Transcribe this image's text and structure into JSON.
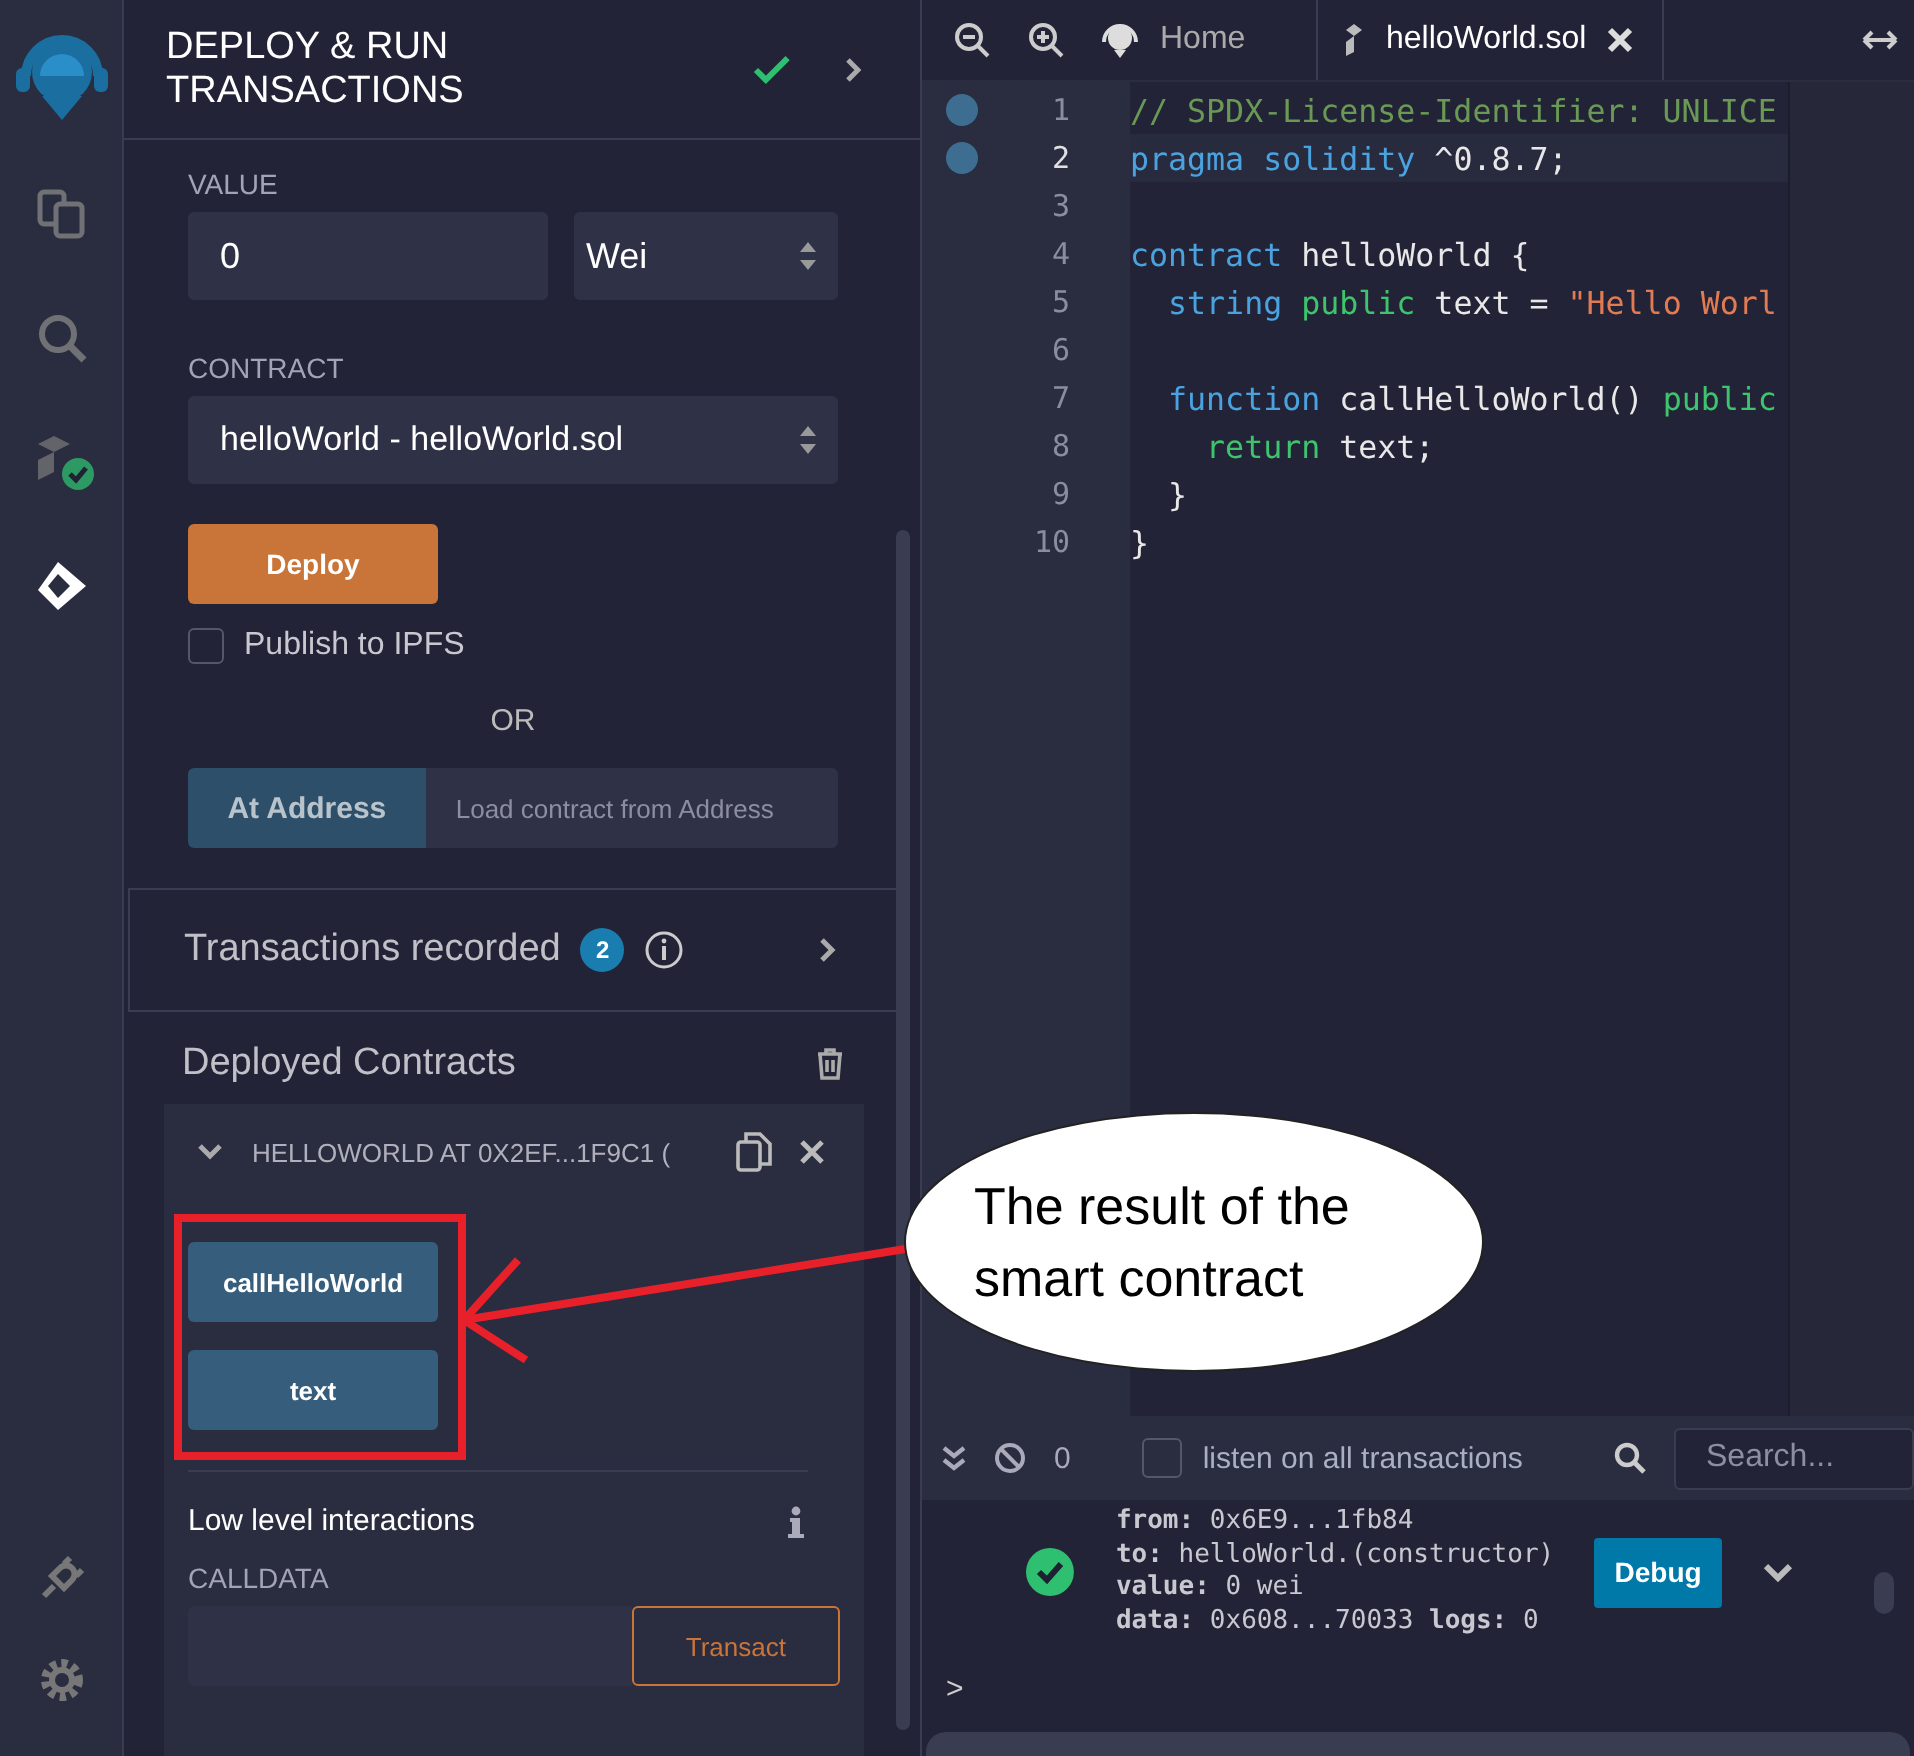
{
  "sidebar_icons": [
    {
      "kind": "files",
      "selected": false
    },
    {
      "kind": "search",
      "selected": false
    },
    {
      "kind": "compiler",
      "selected": false
    },
    {
      "kind": "deploy",
      "selected": true
    }
  ],
  "panel": {
    "title_lines": [
      "DEPLOY & RUN",
      "TRANSACTIONS"
    ],
    "value_label": "VALUE",
    "value": "0",
    "unit": "Wei",
    "contract_label": "CONTRACT",
    "contract": "helloWorld - helloWorld.sol",
    "deploy_button": "Deploy",
    "publish": {
      "label": "Publish to IPFS",
      "checked": false
    },
    "or": "OR",
    "at_address_button": "At Address",
    "address_placeholder": "Load contract from Address",
    "transactions": {
      "label": "Transactions recorded",
      "count": "2"
    },
    "deployed_title": "Deployed Contracts",
    "instance": {
      "title": "HELLOWORLD AT 0X2EF...1F9C1 (",
      "expanded": true,
      "functions": [
        "callHelloWorld",
        "text"
      ],
      "low_level_title": "Low level interactions",
      "calldata_label": "CALLDATA",
      "transact_button": "Transact"
    }
  },
  "editor": {
    "tabs": [
      {
        "label": "Home",
        "kind": "home",
        "selected": false
      },
      {
        "label": "helloWorld.sol",
        "kind": "file",
        "selected": true
      }
    ],
    "lines": [
      {
        "number": "1",
        "current": false,
        "breakpoint": true,
        "tokens": [
          {
            "text": "// SPDX-License-Identifier: UNLICE",
            "color": "#6a9955"
          }
        ]
      },
      {
        "number": "2",
        "current": true,
        "breakpoint": true,
        "tokens": [
          {
            "text": "pragma solidity",
            "color": "#4aa3df"
          },
          {
            "text": " ^0.8.7;",
            "color": "#e8e8e8"
          }
        ]
      },
      {
        "number": "3",
        "current": false,
        "breakpoint": false
      },
      {
        "number": "4",
        "current": false,
        "breakpoint": false,
        "tokens": [
          {
            "text": "contract",
            "color": "#4aa3df"
          },
          {
            "text": " helloWorld {",
            "color": "#e8e8e8"
          }
        ]
      },
      {
        "number": "5",
        "current": false,
        "breakpoint": false,
        "tokens": [
          {
            "text": "  string",
            "color": "#4aa3df"
          },
          {
            "text": " public",
            "color": "#3ec46d"
          },
          {
            "text": " text = ",
            "color": "#e8e8e8"
          },
          {
            "text": "\"Hello Worl",
            "color": "#e07b53"
          }
        ]
      },
      {
        "number": "6",
        "current": false,
        "breakpoint": false
      },
      {
        "number": "7",
        "current": false,
        "breakpoint": false,
        "tokens": [
          {
            "text": "  function",
            "color": "#4aa3df"
          },
          {
            "text": " callHelloWorld() ",
            "color": "#e8e8e8"
          },
          {
            "text": "public",
            "color": "#3ec46d"
          }
        ]
      },
      {
        "number": "8",
        "current": false,
        "breakpoint": false,
        "tokens": [
          {
            "text": "    return",
            "color": "#3ec46d"
          },
          {
            "text": " text;",
            "color": "#e8e8e8"
          }
        ]
      },
      {
        "number": "9",
        "current": false,
        "breakpoint": false,
        "tokens": [
          {
            "text": "  }",
            "color": "#e8e8e8"
          }
        ]
      },
      {
        "number": "10",
        "current": false,
        "breakpoint": false,
        "tokens": [
          {
            "text": "}",
            "color": "#e8e8e8"
          }
        ]
      }
    ]
  },
  "terminal": {
    "count": "0",
    "listen": {
      "label": "listen on all transactions",
      "checked": false
    },
    "search_placeholder": "Search...",
    "log": {
      "kind": "success",
      "fields": [
        {
          "key": "from:",
          "value": "0x6E9...1fb84"
        },
        {
          "key": "to:",
          "value": "helloWorld.(constructor)"
        },
        {
          "key": "value:",
          "value": "0 wei"
        },
        {
          "key": "data:",
          "value": "0x608...70033 **logs:** 0"
        }
      ],
      "debug_button": "Debug"
    },
    "prompt": ">"
  },
  "annotation": {
    "text": "The result of the smart contract"
  }
}
